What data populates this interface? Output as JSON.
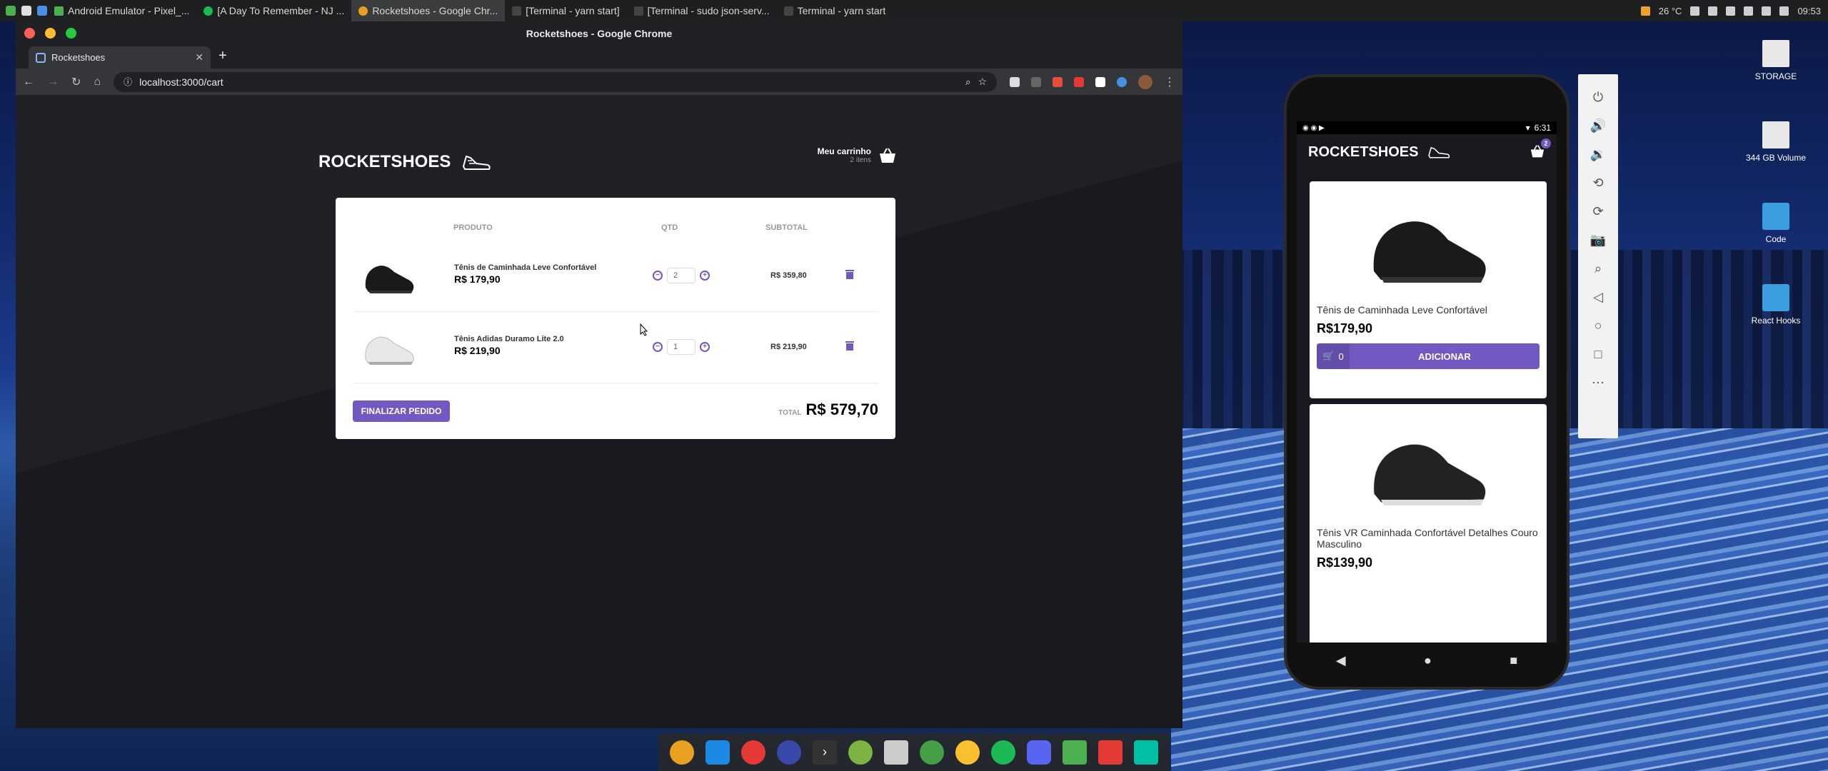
{
  "system": {
    "tasks": [
      {
        "label": "Android Emulator - Pixel_...",
        "color": "#4caf50"
      },
      {
        "label": "[A Day To Remember - NJ ...",
        "color": "#1db954"
      },
      {
        "label": "Rocketshoes - Google Chr...",
        "color": "#e8a020",
        "active": true
      },
      {
        "label": "[Terminal - yarn start]",
        "color": "#444"
      },
      {
        "label": "[Terminal - sudo json-serv...",
        "color": "#444"
      },
      {
        "label": "Terminal - yarn start",
        "color": "#444"
      }
    ],
    "temperature": "26 °C",
    "clock": "09:53"
  },
  "browser": {
    "window_title": "Rocketshoes - Google Chrome",
    "tab_title": "Rocketshoes",
    "url": "localhost:3000/cart"
  },
  "site": {
    "logo": "ROCKETSHOES",
    "cart_label": "Meu carrinho",
    "cart_count": "2 itens"
  },
  "cart": {
    "col_product": "PRODUTO",
    "col_qty": "QTD",
    "col_subtotal": "SUBTOTAL",
    "items": [
      {
        "name": "Tênis de Caminhada Leve Confortável",
        "price": "R$ 179,90",
        "qty": "2",
        "subtotal": "R$ 359,80",
        "shoe_color": "#1a1a1a"
      },
      {
        "name": "Tênis Adidas Duramo Lite 2.0",
        "price": "R$ 219,90",
        "qty": "1",
        "subtotal": "R$ 219,90",
        "shoe_color": "#e8e8e8"
      }
    ],
    "checkout_label": "FINALIZAR PEDIDO",
    "total_label": "TOTAL",
    "total_value": "R$ 579,70"
  },
  "phone": {
    "time": "6:31",
    "logo": "ROCKETSHOES",
    "cart_badge": "2",
    "products": [
      {
        "name": "Tênis de Caminhada Leve Confortável",
        "price": "R$179,90",
        "count": "0",
        "button": "ADICIONAR"
      },
      {
        "name": "Tênis VR Caminhada Confortável Detalhes Couro Masculino",
        "price": "R$139,90"
      }
    ]
  },
  "desktop": {
    "icons": [
      {
        "label": "STORAGE"
      },
      {
        "label": "344 GB Volume"
      },
      {
        "label": "Code"
      },
      {
        "label": "React Hooks"
      }
    ]
  },
  "colors": {
    "accent": "#7159c1",
    "background": "#191920"
  }
}
